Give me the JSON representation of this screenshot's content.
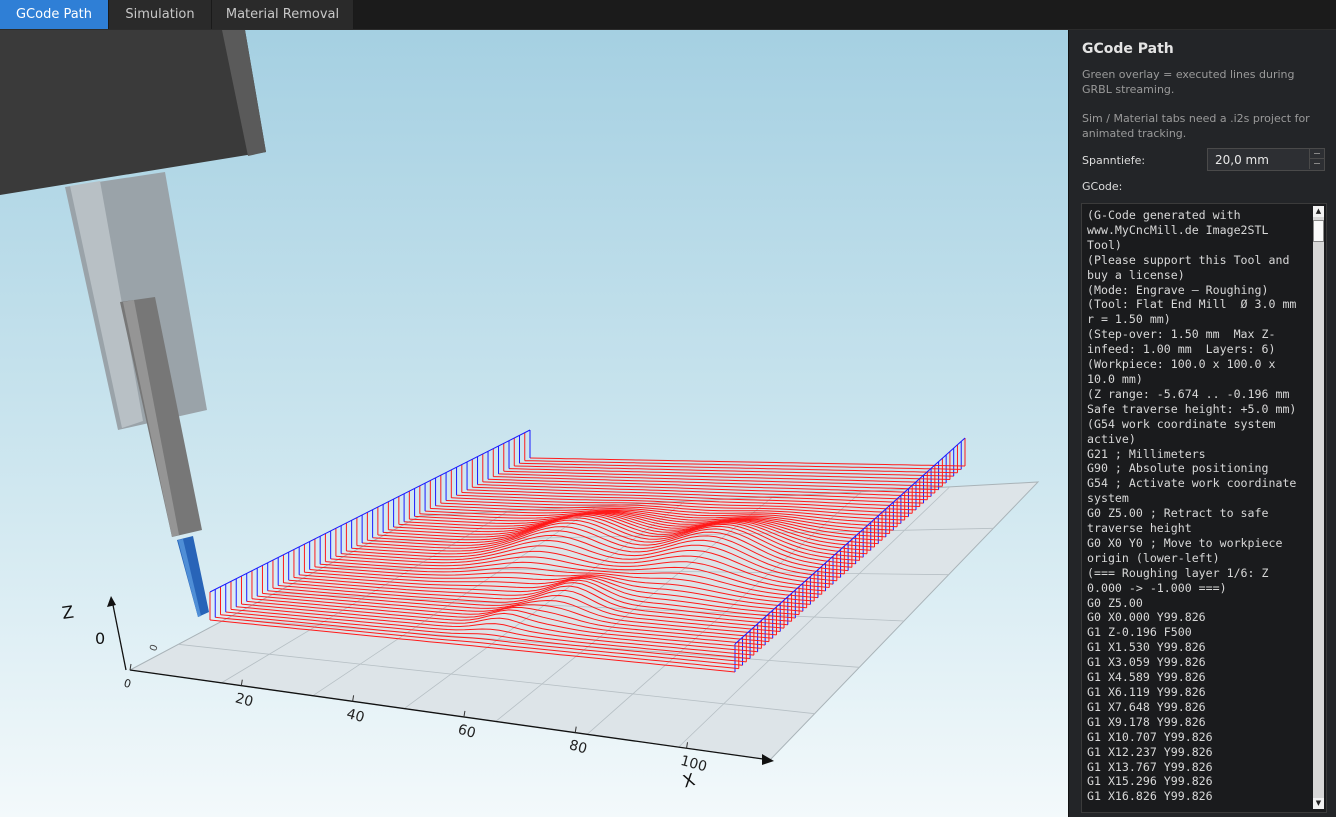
{
  "tabs": [
    {
      "label": "GCode Path",
      "active": true
    },
    {
      "label": "Simulation",
      "active": false
    },
    {
      "label": "Material Removal",
      "active": false
    }
  ],
  "viewport": {
    "axis_z": "Z",
    "axis_x": "X",
    "origin_label": "0",
    "z_tick": "0",
    "x_ticks": [
      "0",
      "20",
      "40",
      "60",
      "80",
      "100"
    ],
    "colors": {
      "toolpath": "#ff1a1a",
      "rapid": "#1a1aff",
      "tool_tip": "#2864b8",
      "bed": "#dde4e8"
    }
  },
  "panel": {
    "title": "GCode Path",
    "note1": "Green overlay = executed lines during GRBL streaming.",
    "note2": "Sim / Material tabs need a .i2s project for animated tracking.",
    "spanntiefe_label": "Spanntiefe:",
    "spanntiefe_value": "20,0 mm",
    "gcode_label": "GCode:",
    "gcode_lines": [
      "(G-Code generated with",
      "www.MyCncMill.de Image2STL",
      "Tool)",
      "(Please support this Tool and",
      "buy a license)",
      "(Mode: Engrave — Roughing)",
      "(Tool: Flat End Mill  Ø 3.0 mm",
      "r = 1.50 mm)",
      "(Step-over: 1.50 mm  Max Z-",
      "infeed: 1.00 mm  Layers: 6)",
      "(Workpiece: 100.0 x 100.0 x",
      "10.0 mm)",
      "(Z range: -5.674 .. -0.196 mm",
      "Safe traverse height: +5.0 mm)",
      "(G54 work coordinate system",
      "active)",
      "G21 ; Millimeters",
      "G90 ; Absolute positioning",
      "G54 ; Activate work coordinate",
      "system",
      "G0 Z5.00 ; Retract to safe",
      "traverse height",
      "G0 X0 Y0 ; Move to workpiece",
      "origin (lower-left)",
      "",
      "(=== Roughing layer 1/6: Z",
      "0.000 -> -1.000 ===)",
      "G0 Z5.00",
      "G0 X0.000 Y99.826",
      "G1 Z-0.196 F500",
      "G1 X1.530 Y99.826",
      "G1 X3.059 Y99.826",
      "G1 X4.589 Y99.826",
      "G1 X6.119 Y99.826",
      "G1 X7.648 Y99.826",
      "G1 X9.178 Y99.826",
      "G1 X10.707 Y99.826",
      "G1 X12.237 Y99.826",
      "G1 X13.767 Y99.826",
      "G1 X15.296 Y99.826",
      "G1 X16.826 Y99.826"
    ]
  }
}
